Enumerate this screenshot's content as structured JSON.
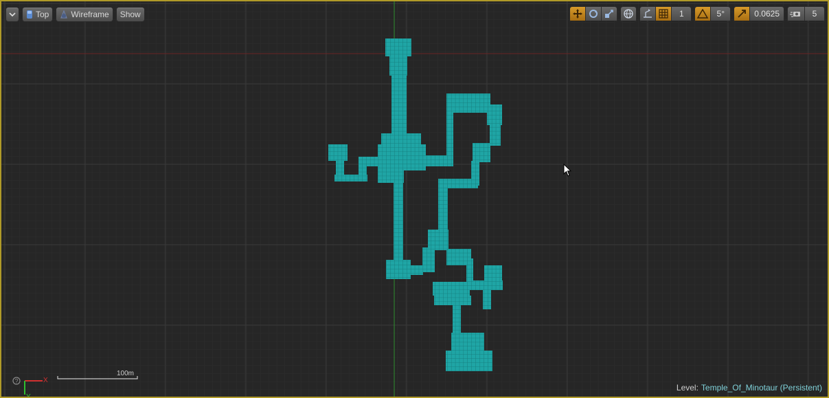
{
  "toolbar_left": {
    "menu_icon": "chevron-down-icon",
    "view_type": "Top",
    "view_mode": "Wireframe",
    "show": "Show"
  },
  "toolbar_right": {
    "grid_snap_value": "1",
    "rotation_snap_value": "5°",
    "scale_snap_value": "0.0625",
    "camera_speed_value": "5",
    "icons": [
      "translate-icon",
      "rotate-icon",
      "scale-icon",
      "world-local-icon",
      "surface-snap-icon",
      "grid-snap-icon",
      "rotation-snap-icon",
      "scale-snap-icon",
      "camera-speed-icon"
    ]
  },
  "scale_bar": {
    "label": "100m"
  },
  "axis_gizmo": {
    "x_label": "X",
    "y_label": "Y"
  },
  "status": {
    "level_label": "Level:",
    "level_name": "Temple_Of_Minotaur (Persistent)"
  },
  "colors": {
    "accent": "#d79a2a",
    "mesh": "#1aa3a3",
    "background": "#262626",
    "border": "#b09a28"
  }
}
